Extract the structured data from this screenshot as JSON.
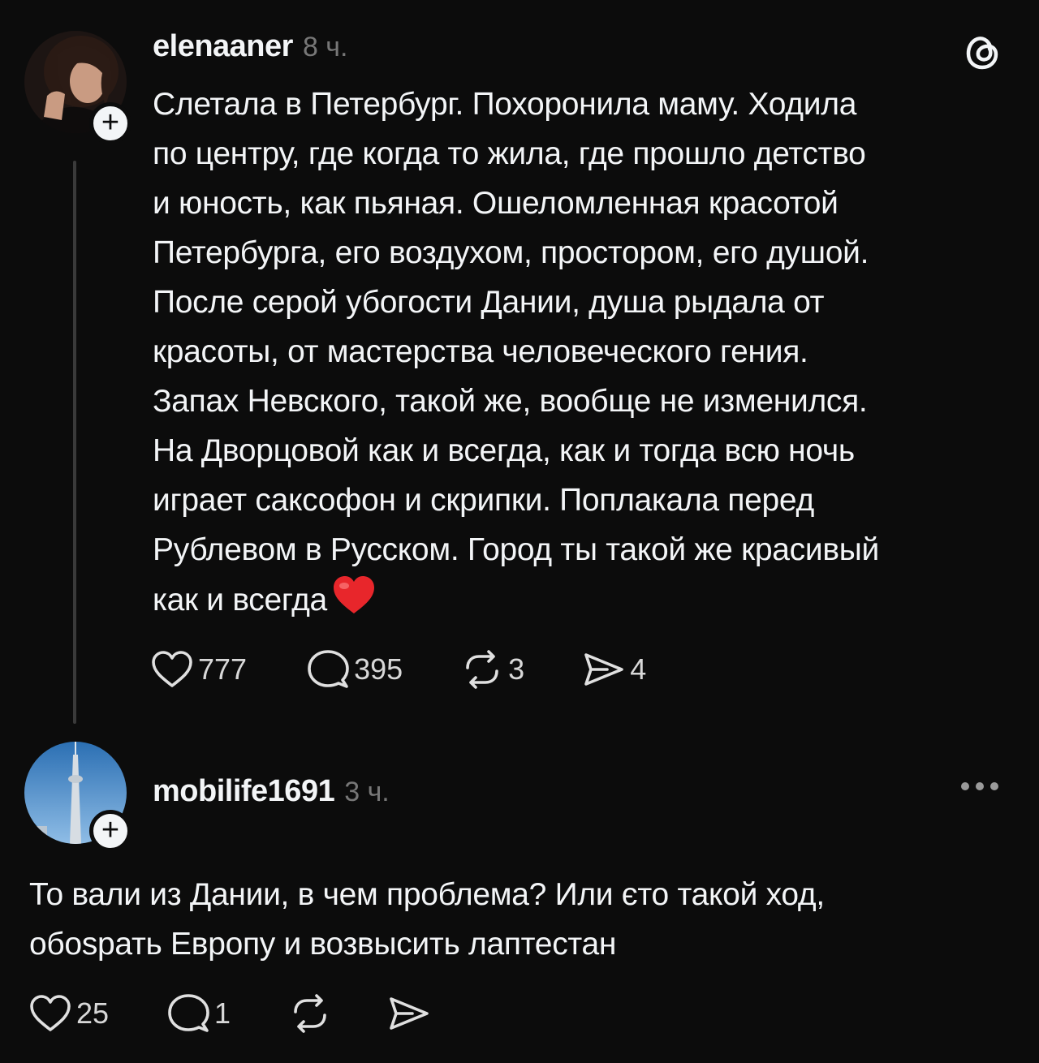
{
  "post": {
    "username": "elenaaner",
    "time": "8 ч.",
    "lines": [
      "Слетала в Петербург. Похоронила маму. Ходила",
      "по центру, где когда то жила, где прошло детство",
      "и юность, как пьяная. Ошеломленная красотой",
      "Петербурга, его воздухом, простором, его душой.",
      "После серой убогости Дании, душа рыдала от",
      "красоты, от мастерства человеческого гения.",
      "Запах Невского, такой же, вообще не изменился.",
      "На Дворцовой как и всегда, как и тогда всю ночь",
      "играет саксофон и скрипки. Поплакала перед",
      "Рублевом в Русском. Город ты такой же красивый",
      "как и всегда"
    ],
    "likes": "777",
    "comments": "395",
    "reposts": "3",
    "shares": "4",
    "follow_badge": "+"
  },
  "reply": {
    "username": "mobilife1691",
    "time": "3 ч.",
    "lines": [
      "То вали из Дании, в чем проблема? Или єто такой ход,",
      "обоsрать Европу и возвысить лаптестан"
    ],
    "likes": "25",
    "comments": "1",
    "follow_badge": "+"
  },
  "icons": {
    "threads": "threads-logo-icon",
    "more": "more-options-icon",
    "like": "heart-icon",
    "comment": "comment-bubble-icon",
    "repost": "repost-icon",
    "share": "send-icon",
    "emoji": "red-heart-emoji"
  },
  "colors": {
    "background": "#0c0c0c",
    "text": "#f3f5f7",
    "muted": "#777777",
    "emoji_heart": "#e8262b"
  }
}
